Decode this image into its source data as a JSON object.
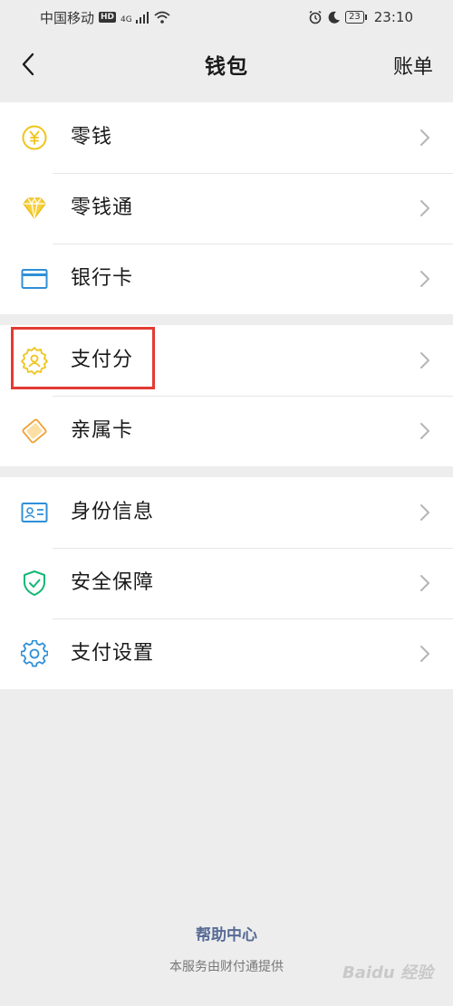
{
  "status_bar": {
    "carrier": "中国移动",
    "hd": "HD",
    "network": "4G",
    "battery": "23",
    "time": "23:10"
  },
  "nav": {
    "title": "钱包",
    "bill": "账单"
  },
  "groups": [
    {
      "items": [
        {
          "label": "零钱",
          "icon": "yuan-coin-icon"
        },
        {
          "label": "零钱通",
          "icon": "diamond-icon"
        },
        {
          "label": "银行卡",
          "icon": "bank-card-icon"
        }
      ]
    },
    {
      "items": [
        {
          "label": "支付分",
          "icon": "pay-score-badge-icon"
        },
        {
          "label": "亲属卡",
          "icon": "family-card-icon"
        }
      ]
    },
    {
      "items": [
        {
          "label": "身份信息",
          "icon": "id-card-icon"
        },
        {
          "label": "安全保障",
          "icon": "shield-check-icon"
        },
        {
          "label": "支付设置",
          "icon": "gear-icon"
        }
      ]
    }
  ],
  "footer": {
    "help": "帮助中心",
    "note": "本服务由财付通提供"
  },
  "watermark": "Baidu 经验",
  "colors": {
    "highlight": "#e23b33",
    "link": "#576b95",
    "yellow": "#f0c419",
    "blue": "#2f8fd8",
    "green": "#16b777"
  }
}
